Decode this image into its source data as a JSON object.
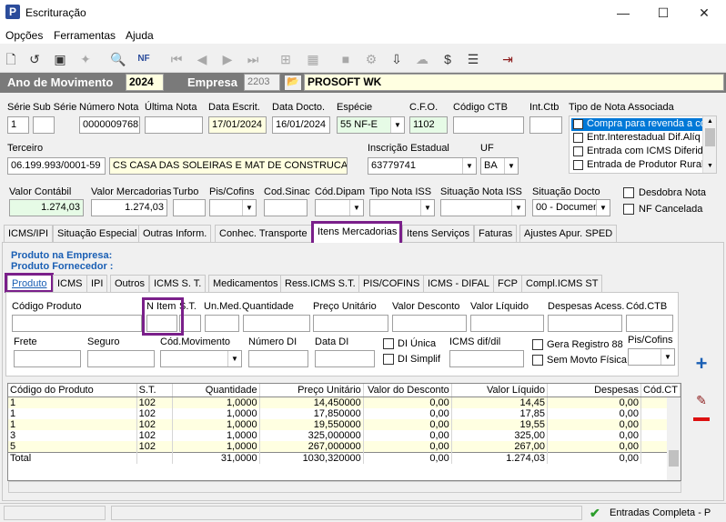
{
  "window": {
    "title": "Escrituração",
    "minimize": "—",
    "maximize": "☐",
    "close": "✕",
    "app_icon": "P"
  },
  "menu": [
    "Opções",
    "Ferramentas",
    "Ajuda"
  ],
  "yearbar": {
    "ano_label": "Ano de Movimento",
    "ano": "2024",
    "empresa_label": "Empresa",
    "empresa_code": "2203",
    "empresa_name": "PROSOFT WK"
  },
  "header": {
    "serie_label": "Série",
    "serie": "1",
    "subserie_label": "Sub Série",
    "subserie": "",
    "numero_label": "Número Nota",
    "numero": "0000009768",
    "ultima_label": "Última Nota",
    "ultima": "",
    "data_escrit_label": "Data Escrit.",
    "data_escrit": "17/01/2024",
    "data_docto_label": "Data Docto.",
    "data_docto": "16/01/2024",
    "especie_label": "Espécie",
    "especie": "55  NF-E",
    "cfo_label": "C.F.O.",
    "cfo": "1102",
    "codigo_ctb_label": "Código CTB",
    "codigo_ctb": "",
    "int_ctb_label": "Int.Ctb",
    "int_ctb": "",
    "tipo_nota_label": "Tipo de Nota Associada",
    "tipo_nota_options": [
      "Compra para revenda a co",
      "Entr.Interestadual Dif.Alíq",
      "Entrada com ICMS Diferido",
      "Entrada de Produtor Rural"
    ],
    "terceiro_label": "Terceiro",
    "terceiro_cnpj": "06.199.993/0001-59",
    "terceiro_nome": "CS CASA DAS SOLEIRAS E MAT DE CONSTRUCAO",
    "ie_label": "Inscrição Estadual",
    "ie": "63779741",
    "uf_label": "UF",
    "uf": "BA"
  },
  "values": {
    "valor_contabil_label": "Valor Contábil",
    "valor_contabil": "1.274,03",
    "valor_mercadorias_label": "Valor Mercadorias",
    "valor_mercadorias": "1.274,03",
    "turbo_label": "Turbo",
    "turbo": "",
    "pis_cofins_label": "Pis/Cofins",
    "cod_sinac_label": "Cod.Sinac",
    "cod_dipam_label": "Cód.Dipam",
    "tipo_iss_label": "Tipo Nota ISS",
    "situacao_iss_label": "Situação Nota ISS",
    "situacao_docto_label": "Situação Docto",
    "situacao_docto": "00 - Documen",
    "desdobra_label": "Desdobra Nota",
    "cancelada_label": "NF Cancelada"
  },
  "main_tabs": [
    "ICMS/IPI",
    "Situação Especial",
    "Outras Inform.",
    "Conhec. Transporte",
    "Itens Mercadorias",
    "Itens Serviços",
    "Faturas",
    "Ajustes Apur. SPED"
  ],
  "produto_empresa": "Produto na Empresa:",
  "produto_fornecedor": "Produto Fornecedor :",
  "sub_tabs": [
    "Produto",
    "ICMS",
    "IPI",
    "Outros",
    "ICMS S. T.",
    "Medicamentos",
    "Ress.ICMS S.T.",
    "PIS/COFINS",
    "ICMS - DIFAL",
    "FCP",
    "Compl.ICMS ST"
  ],
  "form": {
    "codigo_produto": "Código Produto",
    "n_item": "N Item",
    "st": "S.T.",
    "un_med": "Un.Med.",
    "quantidade": "Quantidade",
    "preco_unitario": "Preço Unitário",
    "valor_desconto": "Valor Desconto",
    "valor_liquido": "Valor Líquido",
    "despesas_acess": "Despesas Acess.",
    "cod_ctb": "Cód.CTB",
    "frete": "Frete",
    "seguro": "Seguro",
    "cod_movimento": "Cód.Movimento",
    "numero_di": "Número DI",
    "data_di": "Data DI",
    "di_unica": "DI Única",
    "di_simplif": "DI Simplif",
    "icms_dif": "ICMS dif/dil",
    "gera_registro": "Gera Registro 88",
    "sem_movto": "Sem Movto Física",
    "pis_cofins": "Pis/Cofins"
  },
  "grid": {
    "headers": [
      "Código do Produto",
      "S.T.",
      "Quantidade",
      "Preço Unitário",
      "Valor do Desconto",
      "Valor Líquido",
      "Despesas",
      "Cód.CT"
    ],
    "rows": [
      [
        "1",
        "102",
        "1,0000",
        "14,450000",
        "0,00",
        "14,45",
        "0,00",
        ""
      ],
      [
        "1",
        "102",
        "1,0000",
        "17,850000",
        "0,00",
        "17,85",
        "0,00",
        ""
      ],
      [
        "1",
        "102",
        "1,0000",
        "19,550000",
        "0,00",
        "19,55",
        "0,00",
        ""
      ],
      [
        "3",
        "102",
        "1,0000",
        "325,000000",
        "0,00",
        "325,00",
        "0,00",
        ""
      ],
      [
        "5",
        "102",
        "1,0000",
        "267,000000",
        "0,00",
        "267,00",
        "0,00",
        ""
      ]
    ],
    "total": [
      "Total",
      "",
      "31,0000",
      "1030,320000",
      "0,00",
      "1.274,03",
      "0,00",
      ""
    ]
  },
  "status": {
    "text": "Entradas Completa - P"
  },
  "colors": {
    "highlight": "#7a1f8a",
    "row_alt": "#ffffe1",
    "selected": "#0078d7",
    "yearbar": "#7a7a7a"
  }
}
